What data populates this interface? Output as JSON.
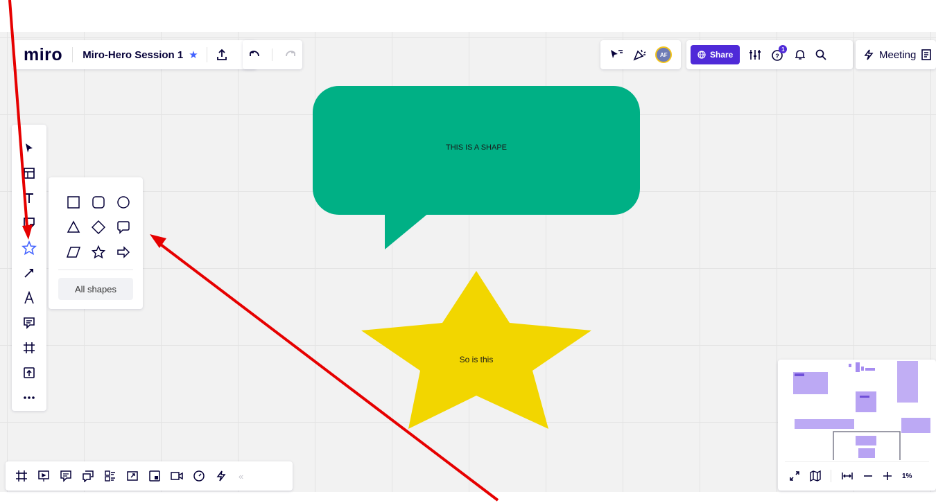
{
  "header": {
    "logo": "miro",
    "board_title": "Miro-Hero Session 1",
    "share_label": "Share",
    "notification_count": "1",
    "avatar_initials": "AF",
    "meeting_label": "Meeting"
  },
  "shapes_popup": {
    "all_shapes_label": "All shapes"
  },
  "canvas": {
    "bubble_text": "THIS IS A SHAPE",
    "bubble_color": "#00b085",
    "star_text": "So is this",
    "star_color": "#f2d600"
  },
  "minimap": {
    "zoom_level": "1%"
  },
  "colors": {
    "accent": "#4262ff",
    "share_button": "#4f2ad8",
    "annotation_arrow": "#e60000"
  }
}
